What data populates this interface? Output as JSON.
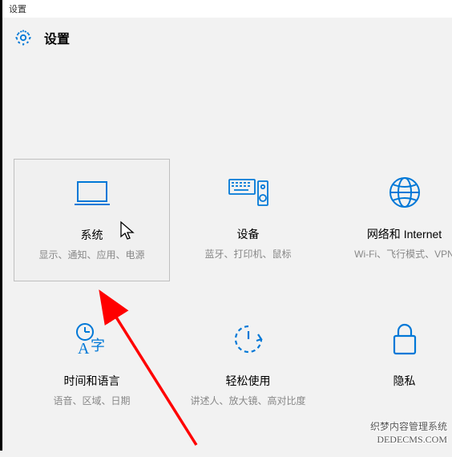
{
  "window": {
    "title": "设置"
  },
  "header": {
    "title": "设置"
  },
  "tiles": [
    {
      "title": "系统",
      "desc": "显示、通知、应用、电源"
    },
    {
      "title": "设备",
      "desc": "蓝牙、打印机、鼠标"
    },
    {
      "title": "网络和 Internet",
      "desc": "Wi-Fi、飞行模式、VPN"
    },
    {
      "title": "时间和语言",
      "desc": "语音、区域、日期"
    },
    {
      "title": "轻松使用",
      "desc": "讲述人、放大镜、高对比度"
    },
    {
      "title": "隐私",
      "desc": ""
    }
  ],
  "watermark": {
    "line1": "织梦内容管理系统",
    "line2": "DEDECMS.COM"
  },
  "colors": {
    "accent": "#0078d7",
    "muted": "#888888"
  }
}
